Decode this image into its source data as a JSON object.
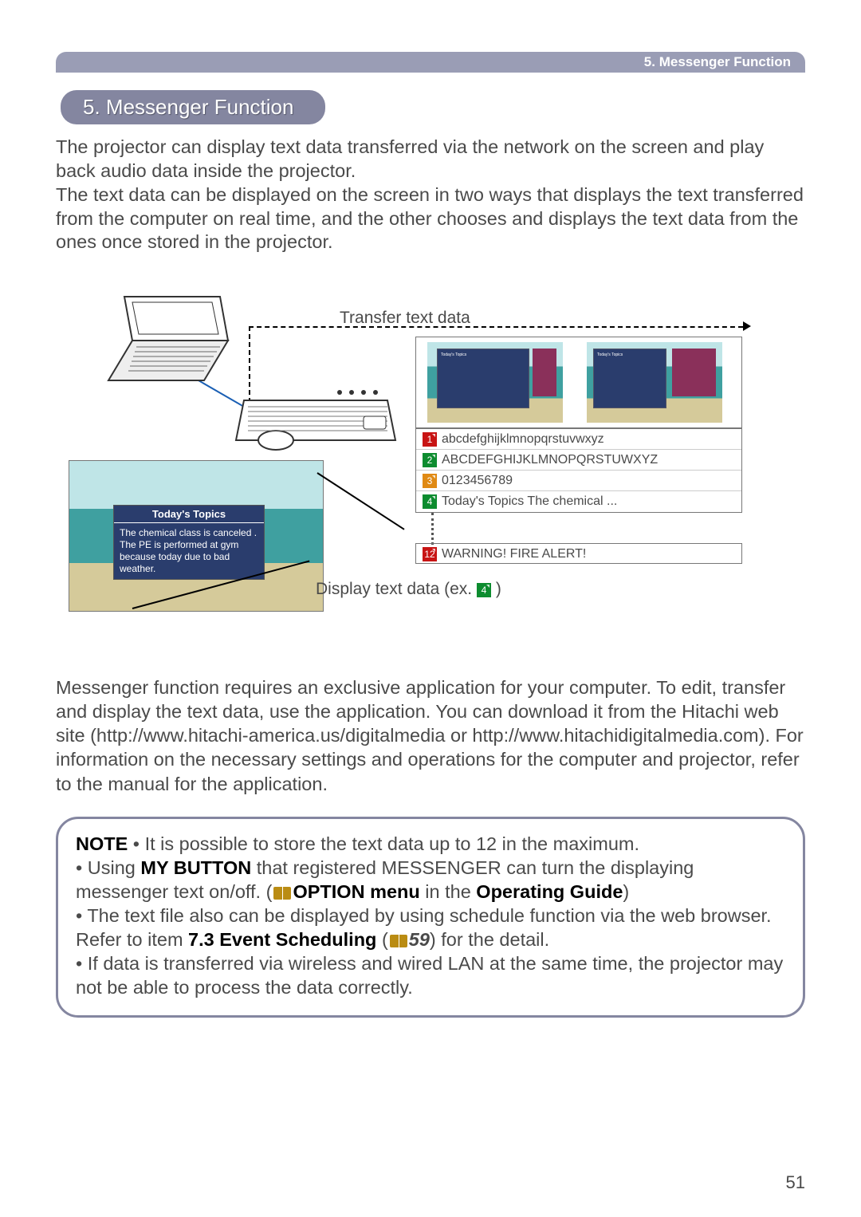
{
  "header": {
    "breadcrumb": "5. Messenger Function"
  },
  "section": {
    "title": "5. Messenger Function"
  },
  "intro": {
    "p1": "The projector can display text data transferred via the network on the screen and play back audio data inside the projector.",
    "p2": "The text data can be displayed on the screen in two ways that displays the text transferred from the computer on real time, and the other chooses and displays the text data from the ones once stored in the projector."
  },
  "diagram": {
    "transfer_label": "Transfer text data",
    "display_label_prefix": "Display text data (ex. ",
    "display_label_suffix": ")",
    "display_badge_num": "4",
    "projection_card": {
      "title": "Today's Topics",
      "body": "The chemical class is canceled .\nThe PE is performed at gym because today due to bad weather."
    },
    "messages": [
      {
        "n": "1",
        "cls": "b-red",
        "text": "abcdefghijklmnopqrstuvwxyz"
      },
      {
        "n": "2",
        "cls": "b-grn",
        "text": "ABCDEFGHIJKLMNOPQRSTUWXYZ"
      },
      {
        "n": "3",
        "cls": "b-org",
        "text": "0123456789"
      },
      {
        "n": "4",
        "cls": "b-grn",
        "text": "Today's Topics The chemical ..."
      }
    ],
    "warn": {
      "n": "12",
      "cls": "b-red",
      "text": "WARNING! FIRE ALERT!"
    }
  },
  "para2": "Messenger function requires an exclusive application for your computer. To edit, transfer and display the text data, use the application. You can download it from the Hitachi web site (http://www.hitachi-america.us/digitalmedia or http://www.hitachidigitalmedia.com). For information on the necessary settings and operations for the computer and projector, refer to the manual for the application.",
  "note": {
    "label": "NOTE",
    "bullets": {
      "b1": " • It is possible to store the text data up to 12 in the maximum.",
      "b2a": "• Using ",
      "b2_my_button": "MY BUTTON",
      "b2b": " that registered MESSENGER can turn the displaying messenger text on/off. (",
      "b2_option": "OPTION menu",
      "b2c": " in the ",
      "b2_guide": "Operating Guide",
      "b2d": ")",
      "b3a": "• The text file also can be displayed by using schedule function via the web browser. Refer to item ",
      "b3_event": "7.3 Event Scheduling",
      "b3b": " (",
      "b3_pg": "59",
      "b3c": ") for the detail.",
      "b4": "• If data is transferred via wireless and wired LAN at the same time, the projector may not be able to process the data correctly."
    }
  },
  "page_number": "51"
}
